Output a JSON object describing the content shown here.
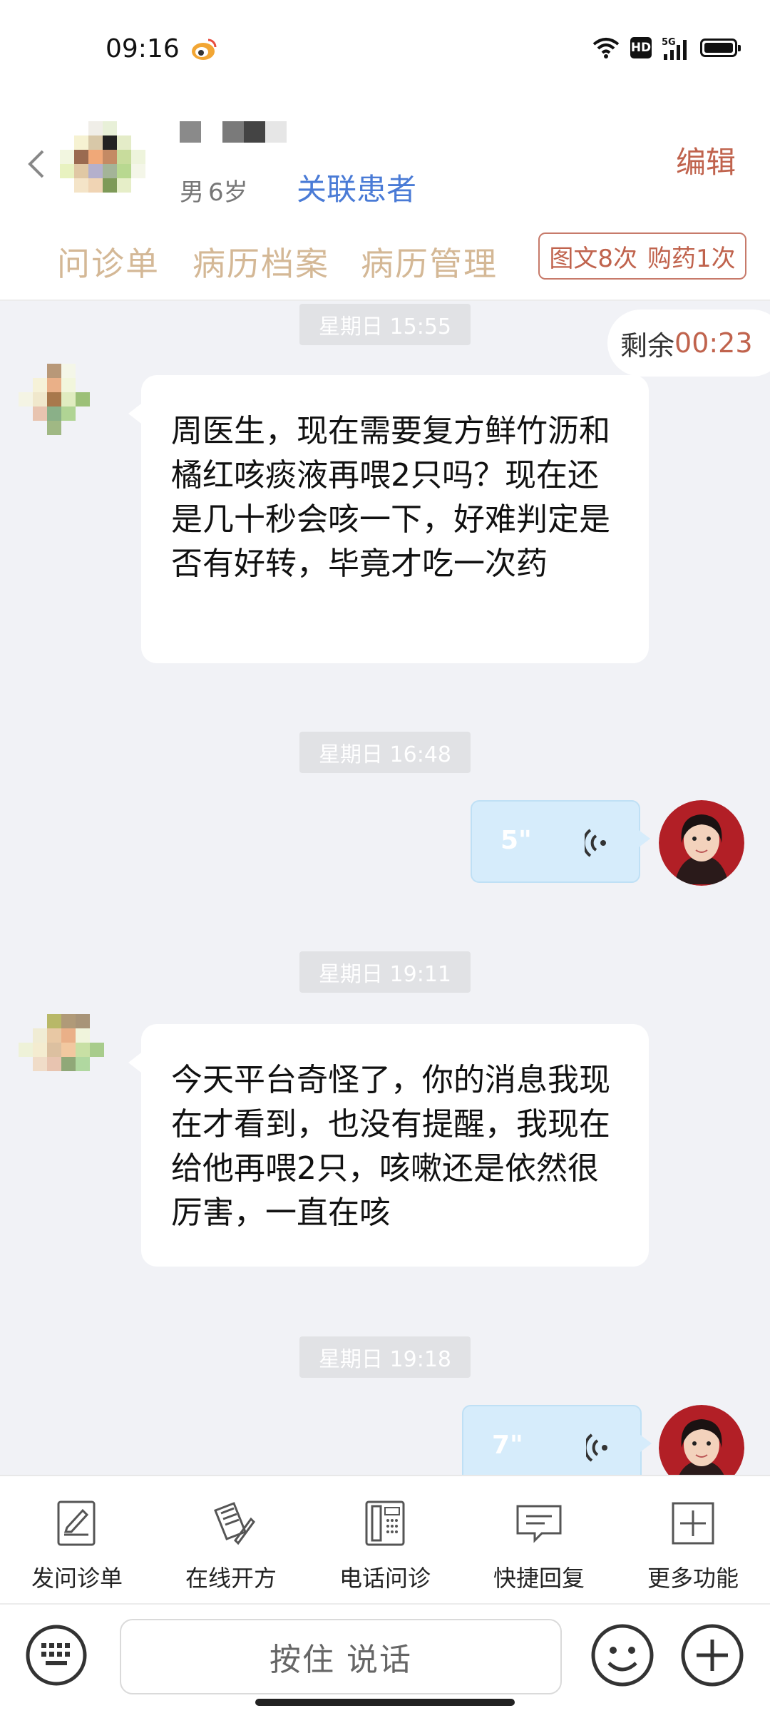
{
  "status_bar": {
    "time": "09:16",
    "network": "5G",
    "hd_label": "HD",
    "icons": [
      "weibo-icon",
      "wifi-icon",
      "hd-icon",
      "signal-icon",
      "battery-icon"
    ]
  },
  "header": {
    "gender": "男",
    "age": "6岁",
    "link_patient_label": "关联患者",
    "edit_label": "编辑"
  },
  "tabs": [
    {
      "label": "问诊单"
    },
    {
      "label": "病历档案"
    },
    {
      "label": "病历管理"
    }
  ],
  "stats": {
    "text_consult": "图文8次",
    "drug_purchase": "购药1次"
  },
  "chat": {
    "timer_label": "剩余",
    "timer_value": "00:23",
    "messages": [
      {
        "type": "timestamp",
        "text": "星期日 15:55"
      },
      {
        "type": "text",
        "from": "patient",
        "text": "周医生，现在需要复方鲜竹沥和橘红咳痰液再喂2只吗？现在还是几十秒会咳一下，好难判定是否有好转，毕竟才吃一次药"
      },
      {
        "type": "timestamp",
        "text": "星期日 16:48"
      },
      {
        "type": "voice",
        "from": "doctor",
        "duration": "5\""
      },
      {
        "type": "timestamp",
        "text": "星期日 19:11"
      },
      {
        "type": "text",
        "from": "patient",
        "text": "今天平台奇怪了，你的消息我现在才看到，也没有提醒，我现在给他再喂2只，咳嗽还是依然很厉害，一直在咳"
      },
      {
        "type": "timestamp",
        "text": "星期日 19:18"
      },
      {
        "type": "voice",
        "from": "doctor",
        "duration": "7\""
      }
    ]
  },
  "toolbar": [
    {
      "label": "发问诊单",
      "icon": "form-edit-icon"
    },
    {
      "label": "在线开方",
      "icon": "prescription-icon"
    },
    {
      "label": "电话问诊",
      "icon": "phone-icon"
    },
    {
      "label": "快捷回复",
      "icon": "quick-reply-icon"
    },
    {
      "label": "更多功能",
      "icon": "more-icon"
    }
  ],
  "input": {
    "hold_to_talk": "按住 说话"
  },
  "colors": {
    "accent": "#c0634d",
    "link": "#4a7bd6",
    "tab": "#d4b896",
    "voice_bubble": "#d6ecfb",
    "chat_bg": "#f1f2f6"
  }
}
